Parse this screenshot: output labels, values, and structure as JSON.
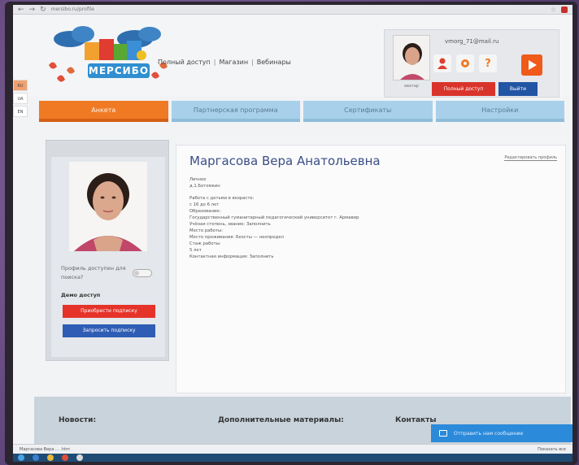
{
  "browser": {
    "url": "mersibo.ru/profile"
  },
  "header": {
    "logo_text": "МЕРСИБО",
    "links": [
      "Полный доступ",
      "Магазин",
      "Вебинары"
    ],
    "user_email": "vmorg_71@mail.ru",
    "user_caption": "аватар",
    "full_access_label": "Полный доступ",
    "exit_label": "Выйти",
    "brand_orange": "#f05a1a",
    "brand_blue": "#2255a4"
  },
  "side_tabs": [
    "RU",
    "UA",
    "EN"
  ],
  "tabs": [
    {
      "label": "Анкета",
      "active": true
    },
    {
      "label": "Партнерская программа",
      "active": false
    },
    {
      "label": "Сертификаты",
      "active": false
    },
    {
      "label": "Настройки",
      "active": false
    }
  ],
  "sidebar": {
    "search_label": "Профиль доступен для поиска?",
    "access_label": "Демо доступ",
    "buy_label": "Приобрести подписку",
    "request_label": "Запросить подписку"
  },
  "profile": {
    "name": "Маргасова Вера Анатольевна",
    "edit_link": "Редактировать профиль",
    "gender_label": "Личное",
    "birthdate": "д.1.Ботомкин",
    "lines": [
      "Работа с детьми в возрасте:",
      "с 16 до 6 лет",
      "Образование:",
      "Государственный гуманитарный педагогический университет г. Армавир",
      "Учёная степень, звание: Заполнить",
      "Место работы:",
      "Место проживания: Беэсты — неопредел",
      "Стаж работы:",
      "5 лет",
      "Контактная информация: Заполнить"
    ]
  },
  "footer": {
    "news": "Новости:",
    "materials": "Дополнительные материалы:",
    "contacts": "Контакты",
    "feedback": "Отправить нам сообщение"
  },
  "status_bar": {
    "left": "Маргасова Вера ... .htm",
    "right": "Показать все"
  }
}
